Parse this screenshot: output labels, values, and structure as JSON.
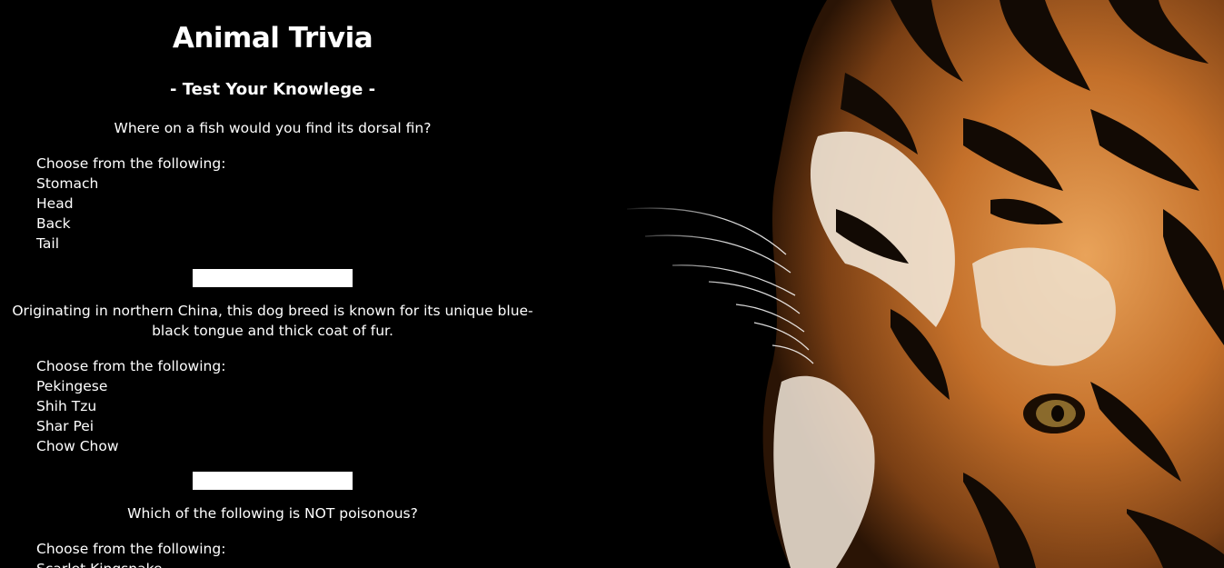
{
  "header": {
    "title": "Animal Trivia",
    "subtitle": "- Test Your Knowlege -"
  },
  "questions": [
    {
      "prompt": "Where on a fish would you find its dorsal fin?",
      "choices_label": "Choose from the following:",
      "choices": [
        "Stomach",
        "Head",
        "Back",
        "Tail"
      ],
      "answer_value": ""
    },
    {
      "prompt": "Originating in northern China, this dog breed is known for its unique blue-black tongue and thick coat of fur.",
      "choices_label": "Choose from the following:",
      "choices": [
        "Pekingese",
        "Shih Tzu",
        "Shar Pei",
        "Chow Chow"
      ],
      "answer_value": ""
    },
    {
      "prompt": "Which of the following is NOT poisonous?",
      "choices_label": "Choose from the following:",
      "choices": [
        "Scarlet Kingsnake"
      ]
    }
  ],
  "background_image": {
    "icon": "tiger-face-image"
  },
  "colors": {
    "background": "#000000",
    "text": "#ffffff",
    "input_background": "#ffffff"
  }
}
